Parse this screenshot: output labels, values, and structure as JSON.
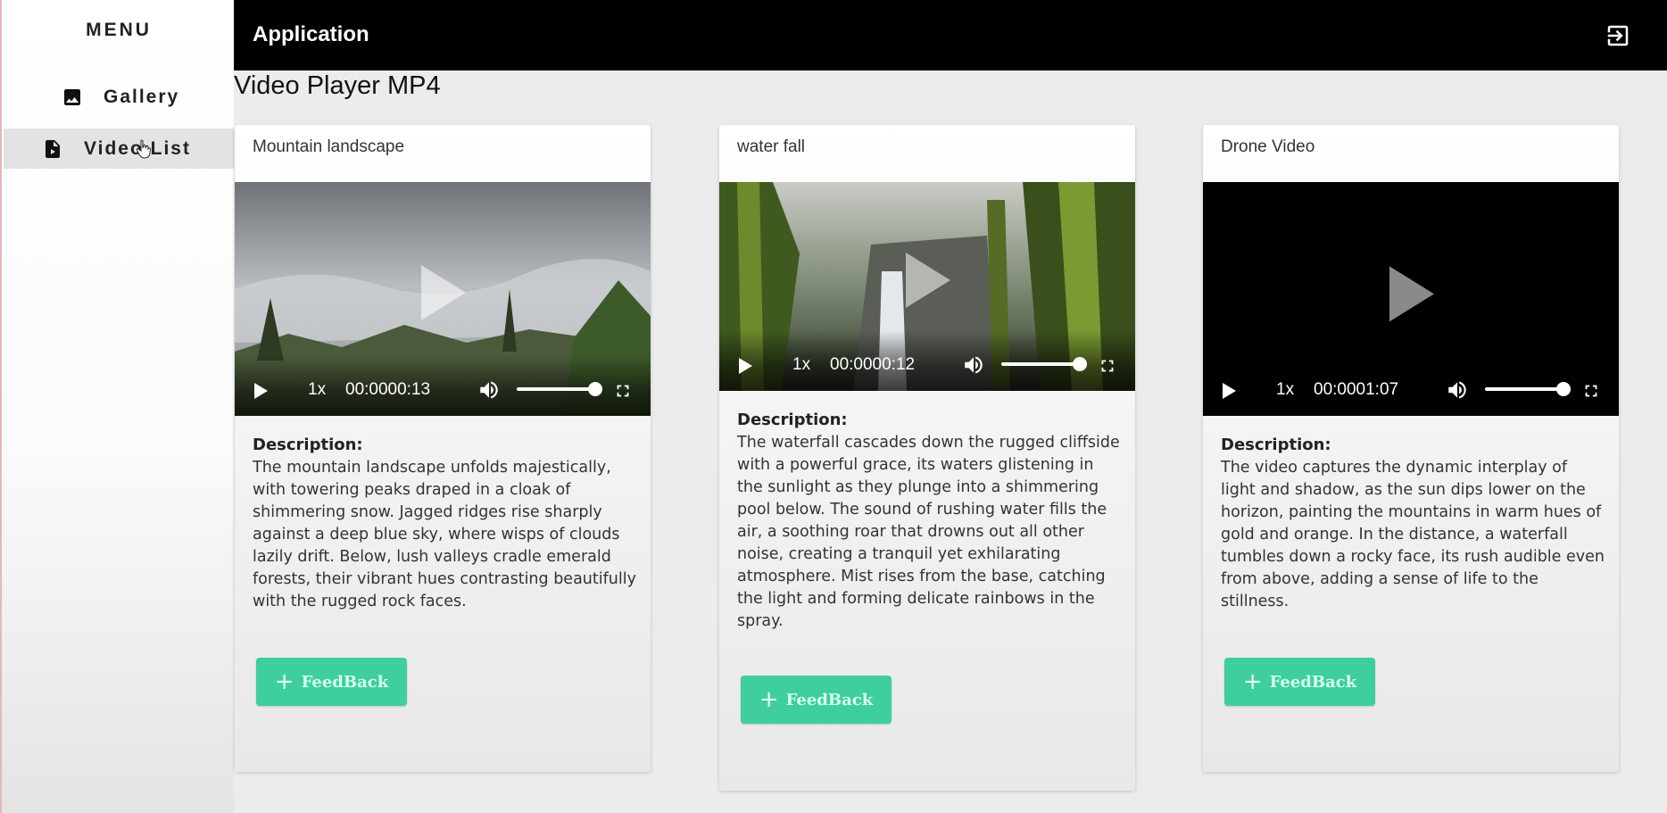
{
  "sidebar": {
    "title": "MENU",
    "items": [
      {
        "label": "Gallery",
        "icon": "image-icon",
        "active": false
      },
      {
        "label": "Video List",
        "icon": "video-file-icon",
        "active": true
      }
    ]
  },
  "header": {
    "app_title": "Application",
    "logout_icon": "logout-icon"
  },
  "page": {
    "title": "Video Player MP4"
  },
  "cards": [
    {
      "title": "Mountain landscape",
      "speed": "1x",
      "time": "00:0000:13",
      "volume": 1.0,
      "description_label": "Description:",
      "description": "The mountain landscape unfolds majestically, with towering peaks draped in a cloak of shimmering snow. Jagged ridges rise sharply against a deep blue sky, where wisps of clouds lazily drift. Below, lush valleys cradle emerald forests, their vibrant hues contrasting beautifully with the rugged rock faces.",
      "feedback_label": "FeedBack"
    },
    {
      "title": "water fall",
      "speed": "1x",
      "time": "00:0000:12",
      "volume": 1.0,
      "description_label": "Description:",
      "description": "The waterfall cascades down the rugged cliffside with a powerful grace, its waters glistening in the sunlight as they plunge into a shimmering pool below. The sound of rushing water fills the air, a soothing roar that drowns out all other noise, creating a tranquil yet exhilarating atmosphere. Mist rises from the base, catching the light and forming delicate rainbows in the spray.",
      "feedback_label": "FeedBack"
    },
    {
      "title": "Drone Video",
      "speed": "1x",
      "time": "00:0001:07",
      "volume": 1.0,
      "description_label": "Description:",
      "description": "The video captures the dynamic interplay of light and shadow, as the sun dips lower on the horizon, painting the mountains in warm hues of gold and orange. In the distance, a waterfall tumbles down a rocky face, its rush audible even from above, adding a sense of life to the stillness.",
      "feedback_label": "FeedBack"
    }
  ],
  "colors": {
    "accent": "#3ecf9c",
    "topbar": "#000000",
    "active_item": "#e3e3e3"
  }
}
